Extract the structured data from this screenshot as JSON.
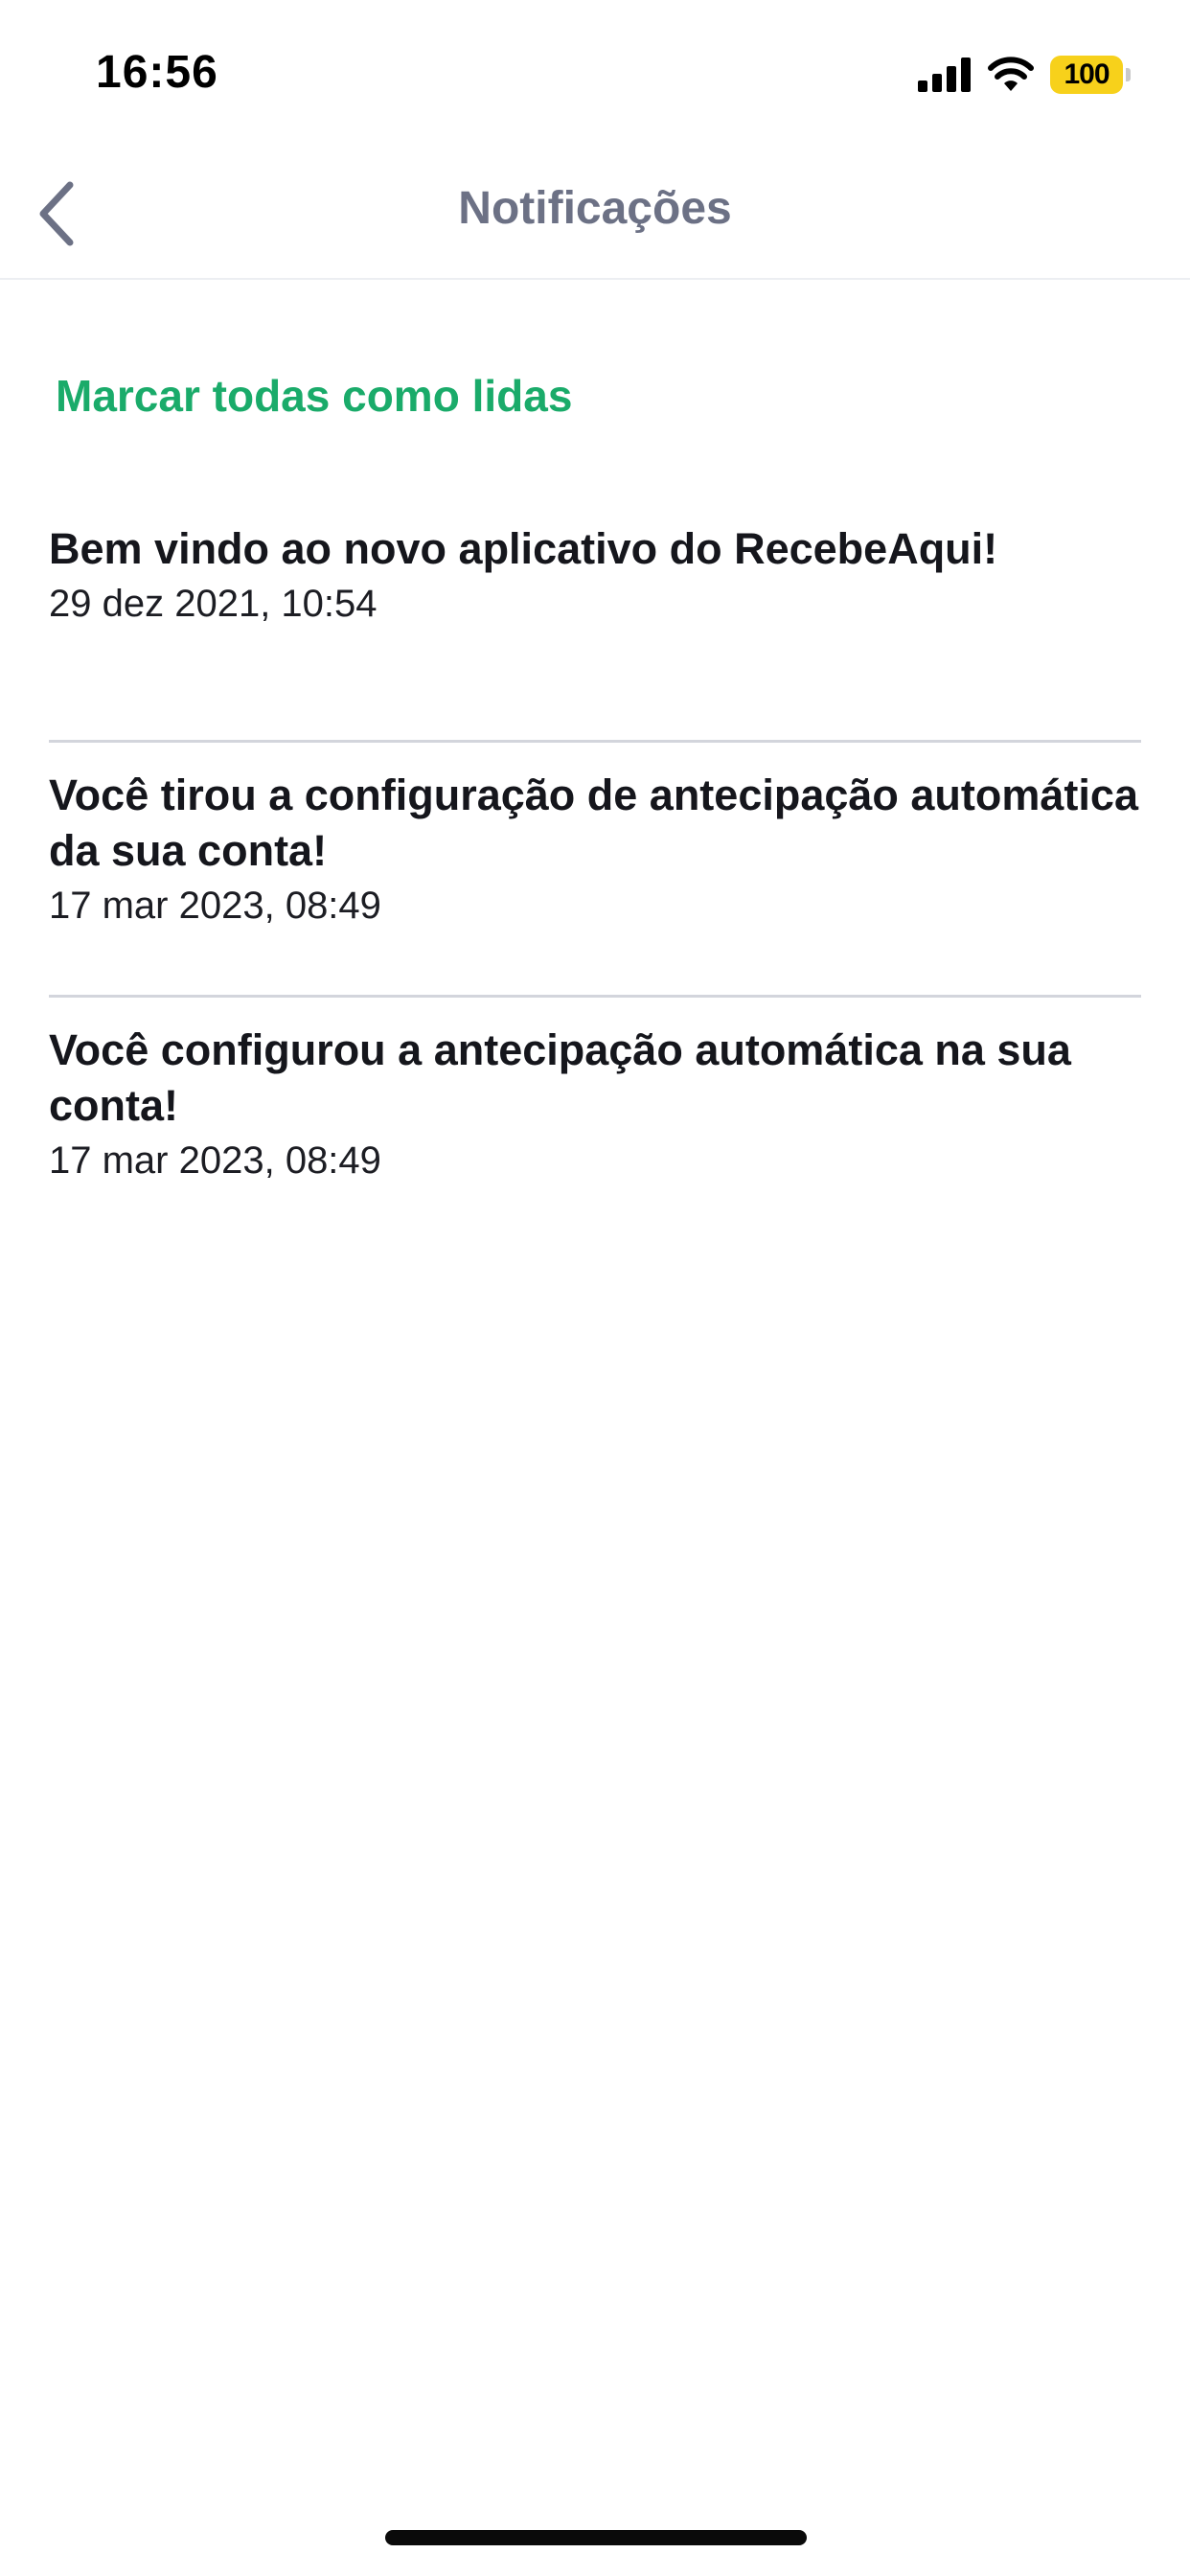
{
  "status_bar": {
    "time": "16:56",
    "battery_level": "100",
    "icons": [
      "signal-icon",
      "wifi-icon",
      "battery-icon"
    ]
  },
  "header": {
    "title": "Notificações",
    "back_icon": "chevron-left-icon"
  },
  "actions": {
    "mark_all_read": "Marcar todas como lidas"
  },
  "notifications": [
    {
      "title": "Bem vindo ao novo aplicativo do RecebeAqui!",
      "date": "29 dez 2021, 10:54"
    },
    {
      "title": "Você tirou a configuração de antecipação automática da sua conta!",
      "date": "17 mar 2023, 08:49"
    },
    {
      "title": "Você configurou a antecipação automática na sua conta!",
      "date": "17 mar 2023, 08:49"
    }
  ],
  "colors": {
    "accent_green": "#1aab6a",
    "title_gray": "#6c7185",
    "battery_yellow": "#f7d11b",
    "divider": "#d3d5dc"
  }
}
